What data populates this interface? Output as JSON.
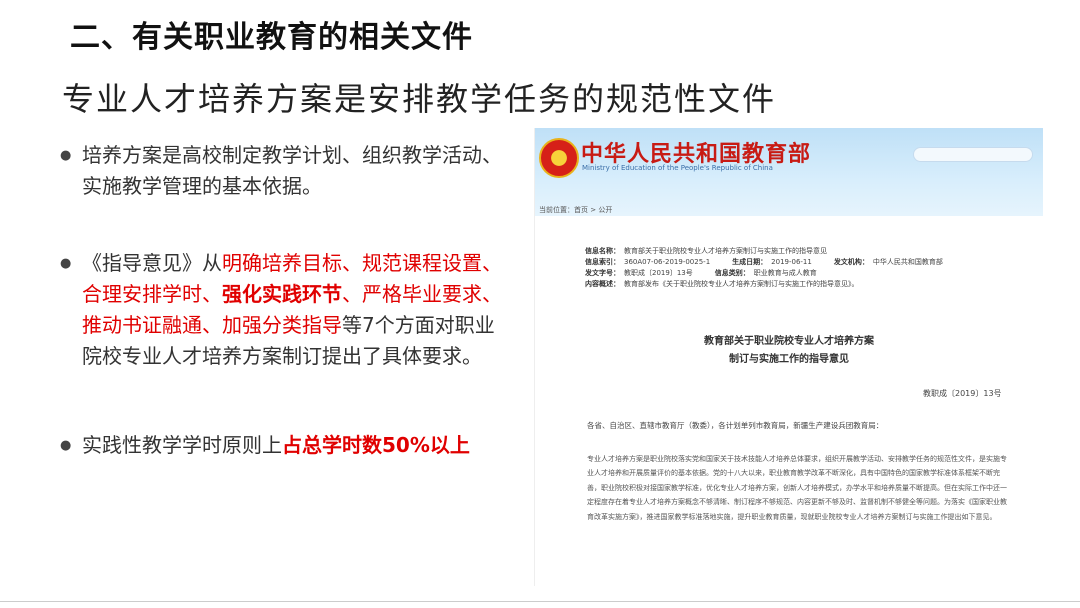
{
  "title": "二、有关职业教育的相关文件",
  "subtitle": "专业人才培养方案是安排教学任务的规范性文件",
  "bullets": {
    "b1": "培养方案是高校制定教学计划、组织教学活动、实施教学管理的基本依据。",
    "b2": {
      "p1": "《指导意见》从",
      "r1": "明确培养目标、规范课程设置、合理安排学时、",
      "rb1": "强化实践环节",
      "r2": "、严格毕业要求、推动书证融通、加强分类指导",
      "p2": "等7个方面对职业院校专业人才培养方案制订提出了具体要求。"
    },
    "b3": {
      "p1": "实践性教学学时原则上",
      "rb1": "占总学时数50%以上"
    }
  },
  "doc": {
    "site_name": "中华人民共和国教育部",
    "site_en": "Ministry of Education of the People's Republic of China",
    "breadcrumb": "当前位置：首页 > 公开",
    "meta": {
      "k_index": "信息名称：",
      "v_index": "教育部关于职业院校专业人才培养方案制订与实施工作的指导意见",
      "k_no": "信息索引：",
      "v_no": "360A07-06-2019-0025-1",
      "k_date": "生成日期：",
      "v_date": "2019-06-11",
      "k_org": "发文机构：",
      "v_org": "中华人民共和国教育部",
      "k_docno": "发文字号：",
      "v_docno": "教职成〔2019〕13号",
      "k_cat": "信息类别：",
      "v_cat": "职业教育与成人教育",
      "k_summary": "内容概述：",
      "v_summary": "教育部发布《关于职业院校专业人才培养方案制订与实施工作的指导意见》。"
    },
    "title_line1": "教育部关于职业院校专业人才培养方案",
    "title_line2": "制订与实施工作的指导意见",
    "docno": "教职成〔2019〕13号",
    "addressee": "各省、自治区、直辖市教育厅（教委），各计划单列市教育局，新疆生产建设兵团教育局：",
    "body": "专业人才培养方案是职业院校落实党和国家关于技术技能人才培养总体要求，组织开展教学活动、安排教学任务的规范性文件，是实施专业人才培养和开展质量评价的基本依据。党的十八大以来，职业教育教学改革不断深化，具有中国特色的国家教学标准体系框架不断完善，职业院校积极对接国家教学标准，优化专业人才培养方案，创新人才培养模式，办学水平和培养质量不断提高。但在实际工作中还一定程度存在着专业人才培养方案概念不够清晰、制订程序不够规范、内容更新不够及时、监督机制不够健全等问题。为落实《国家职业教育改革实施方案》，推进国家教学标准落地实施，提升职业教育质量，现就职业院校专业人才培养方案制订与实施工作提出如下意见。"
  }
}
